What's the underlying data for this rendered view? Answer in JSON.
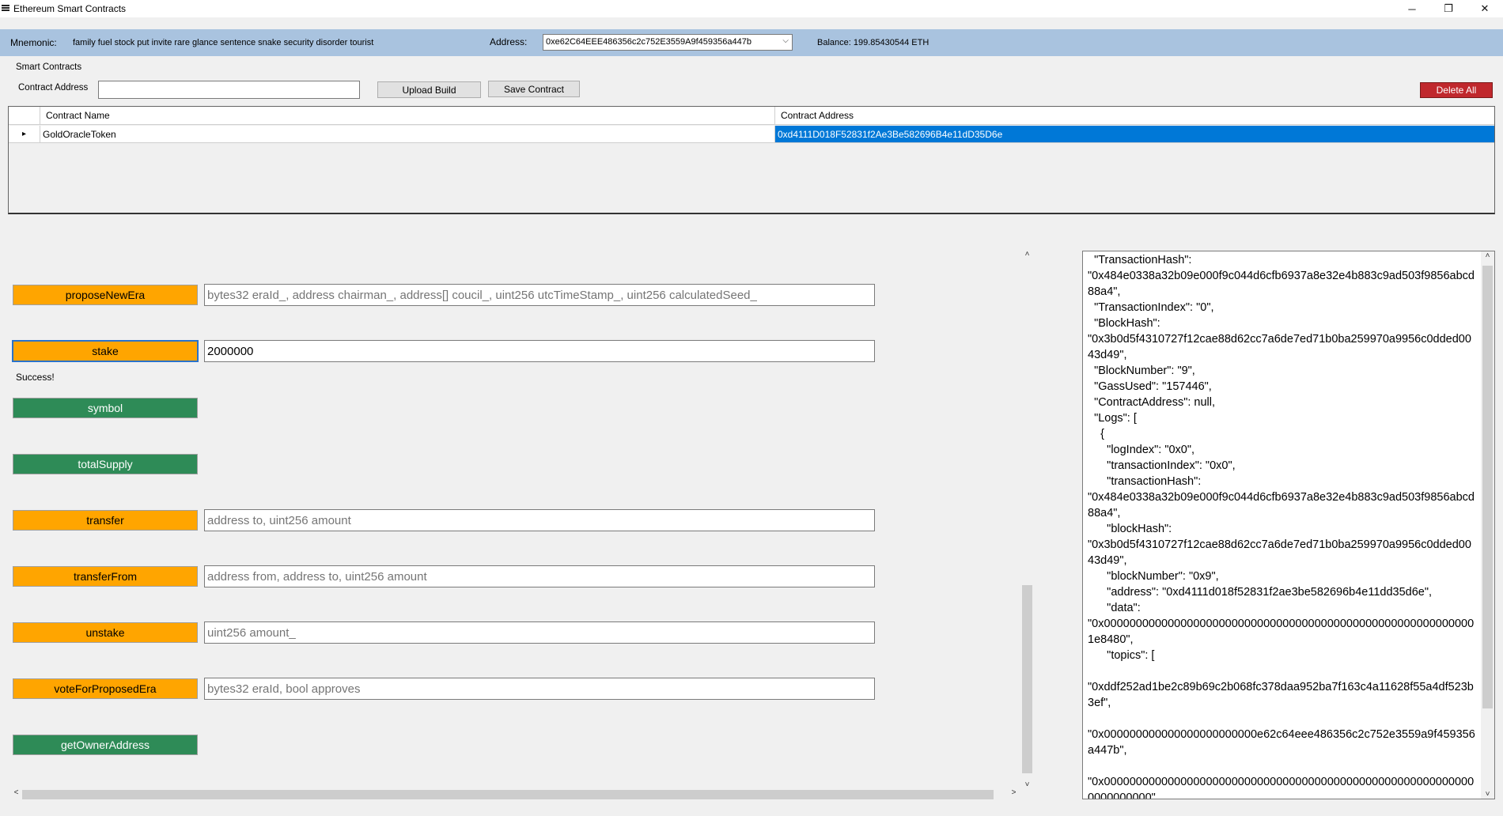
{
  "window": {
    "title": "Ethereum Smart Contracts",
    "controls": {
      "minimize": "─",
      "restore": "❐",
      "close": "✕"
    }
  },
  "topbar": {
    "mnemonic_label": "Mnemonic:",
    "mnemonic_value": "family fuel stock put invite rare glance sentence snake security disorder tourist",
    "address_label": "Address:",
    "address_value": "0xe62C64EEE486356c2c752E3559A9f459356a447b",
    "balance_label": "Balance: 199.85430544 ETH"
  },
  "smart_contracts": {
    "group_label": "Smart Contracts",
    "contract_address_label": "Contract Address",
    "contract_address_value": "",
    "upload_build_label": "Upload Build",
    "save_contract_label": "Save Contract",
    "delete_all_label": "Delete All"
  },
  "grid": {
    "columns": [
      "Contract Name",
      "Contract Address"
    ],
    "rows": [
      {
        "name": "GoldOracleToken",
        "address": "0xd4111D018F52831f2Ae3Be582696B4e11dD35D6e"
      }
    ]
  },
  "functions": [
    {
      "label": "proposeNewEra",
      "color": "orange",
      "input": "",
      "placeholder": "bytes32 eraId_, address chairman_, address[] coucil_, uint256 utcTimeStamp_, uint256 calculatedSeed_"
    },
    {
      "label": "stake",
      "color": "orange",
      "input": "2000000",
      "placeholder": ""
    },
    {
      "label": "symbol",
      "color": "green"
    },
    {
      "label": "totalSupply",
      "color": "green"
    },
    {
      "label": "transfer",
      "color": "orange",
      "input": "",
      "placeholder": "address to, uint256 amount"
    },
    {
      "label": "transferFrom",
      "color": "orange",
      "input": "",
      "placeholder": "address from, address to, uint256 amount"
    },
    {
      "label": "unstake",
      "color": "orange",
      "input": "",
      "placeholder": "uint256 amount_"
    },
    {
      "label": "voteForProposedEra",
      "color": "orange",
      "input": "",
      "placeholder": "bytes32 eraId, bool approves"
    },
    {
      "label": "getOwnerAddress",
      "color": "green"
    }
  ],
  "status": {
    "message": "Success!"
  },
  "colors": {
    "orange": "#ffa500",
    "green": "#2e8b57",
    "header": "#a9c3df",
    "delete": "#c0282d",
    "selection": "#0078d7"
  },
  "log": {
    "text": "  \"TransactionHash\":\n\"0x484e0338a32b09e000f9c044d6cfb6937a8e32e4b883c9ad503f9856abcd88a4\",\n  \"TransactionIndex\": \"0\",\n  \"BlockHash\":\n\"0x3b0d5f4310727f12cae88d62cc7a6de7ed71b0ba259970a9956c0dded0043d49\",\n  \"BlockNumber\": \"9\",\n  \"GassUsed\": \"157446\",\n  \"ContractAddress\": null,\n  \"Logs\": [\n    {\n      \"logIndex\": \"0x0\",\n      \"transactionIndex\": \"0x0\",\n      \"transactionHash\":\n\"0x484e0338a32b09e000f9c044d6cfb6937a8e32e4b883c9ad503f9856abcd88a4\",\n      \"blockHash\":\n\"0x3b0d5f4310727f12cae88d62cc7a6de7ed71b0ba259970a9956c0dded0043d49\",\n      \"blockNumber\": \"0x9\",\n      \"address\": \"0xd4111d018f52831f2ae3be582696b4e11dd35d6e\",\n      \"data\":\n\"0x00000000000000000000000000000000000000000000000000000000001e8480\",\n      \"topics\": [\n\n\"0xddf252ad1be2c89b69c2b068fc378daa952ba7f163c4a11628f55a4df523b3ef\",\n\n\"0x000000000000000000000000e62c64eee486356c2c752e3559a9f459356a447b\",\n\n\"0x00000000000000000000000000000000000000000000000000000000000000000000\""
  }
}
